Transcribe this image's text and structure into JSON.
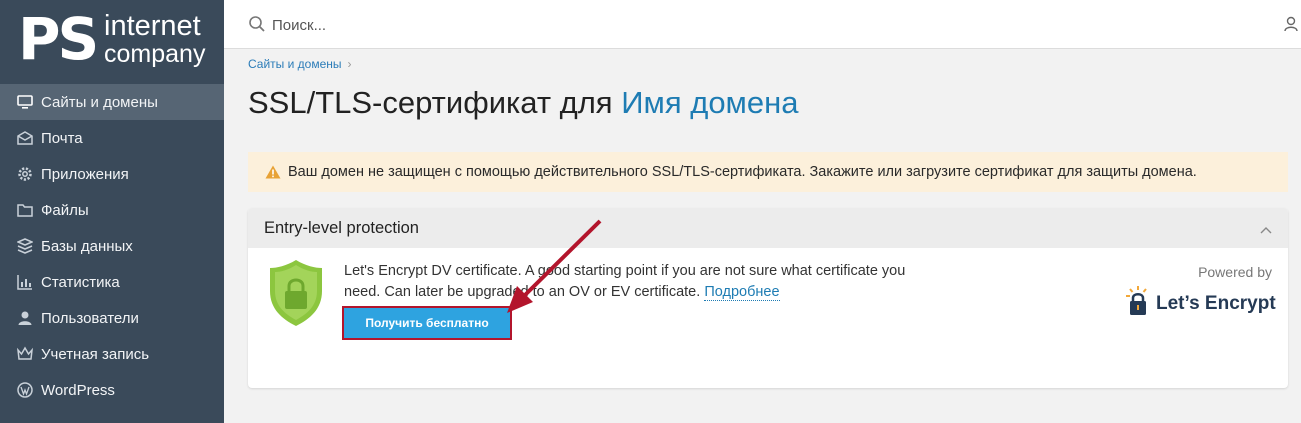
{
  "brand": {
    "logo_ps": "PS",
    "logo_line1": "internet",
    "logo_line2": "company"
  },
  "sidebar": {
    "items": [
      {
        "label": "Сайты и домены",
        "icon": "monitor-icon",
        "active": true
      },
      {
        "label": "Почта",
        "icon": "mail-icon"
      },
      {
        "label": "Приложения",
        "icon": "gear-icon"
      },
      {
        "label": "Файлы",
        "icon": "folder-icon"
      },
      {
        "label": "Базы данных",
        "icon": "database-icon"
      },
      {
        "label": "Статистика",
        "icon": "bar-chart-icon"
      },
      {
        "label": "Пользователи",
        "icon": "user-icon"
      },
      {
        "label": "Учетная запись",
        "icon": "crown-icon"
      },
      {
        "label": "WordPress",
        "icon": "wordpress-icon"
      }
    ]
  },
  "topbar": {
    "search_placeholder": "Поиск..."
  },
  "breadcrumb": {
    "item": "Сайты и домены",
    "separator": "›"
  },
  "page": {
    "title_prefix": "SSL/TLS-сертификат для",
    "title_domain": "Имя домена"
  },
  "alert": {
    "message": "Ваш домен не защищен с помощью действительного SSL/TLS-сертификата. Закажите или загрузите сертификат для защиты домена."
  },
  "card": {
    "title": "Entry-level protection",
    "description": "Let's Encrypt DV certificate. A good starting point if you are not sure what certificate you need. Can later be upgraded to an OV or EV certificate.",
    "more_link": "Подробнее",
    "button": "Получить бесплатно",
    "powered_by": "Powered by",
    "provider_logo": "Let’s Encrypt"
  },
  "colors": {
    "sidebar_bg": "#3a4a5a",
    "accent": "#1e7cb3",
    "button": "#2ea3e0",
    "highlight": "#b3152c",
    "alert_bg": "#fcf0db"
  }
}
